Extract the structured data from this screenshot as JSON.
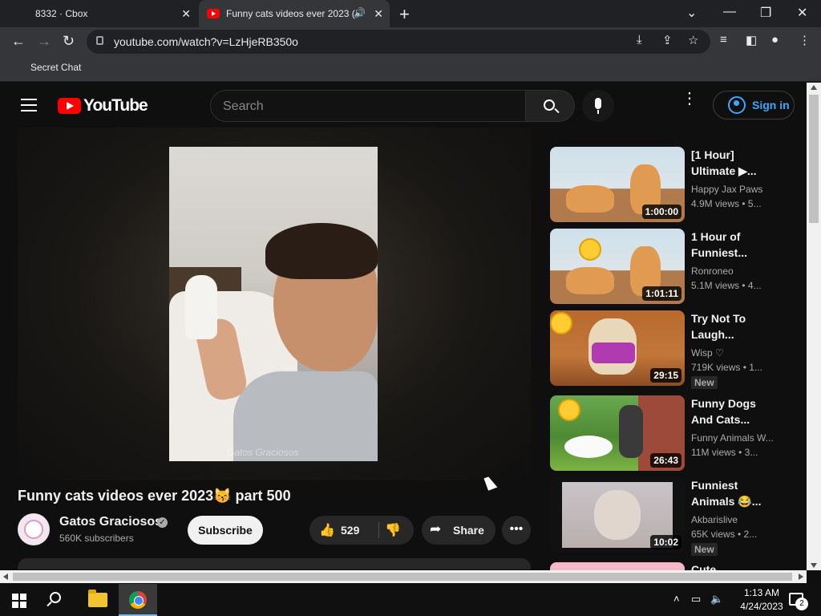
{
  "browser": {
    "tabs": [
      {
        "title": "8332 · Cbox"
      },
      {
        "title": "Funny cats videos ever 2023 (",
        "audio_icon": "speaker-icon"
      }
    ],
    "url": "youtube.com/watch?v=LzHjeRB350o",
    "bookmarks": [
      "Secret Chat"
    ]
  },
  "youtube": {
    "logo_text": "YouTube",
    "search_placeholder": "Search",
    "sign_in_label": "Sign in",
    "accent_color": "#3ea6ff"
  },
  "video": {
    "watermark": "Gatos Graciosos",
    "title": "Funny cats videos ever 2023😽 part 500",
    "channel": "Gatos Graciosos",
    "subscribers": "560K subscribers",
    "subscribe_label": "Subscribe",
    "likes": "529",
    "share_label": "Share"
  },
  "recommendations": [
    {
      "title": "[1 Hour] Ultimate ▶...",
      "channel": "Happy Jax Paws",
      "views": "4.9M views  •  5...",
      "duration": "1:00:00",
      "badge": ""
    },
    {
      "title": "1 Hour of Funniest...",
      "channel": "Ronroneo",
      "views": "5.1M views  •  4...",
      "duration": "1:01:11",
      "badge": ""
    },
    {
      "title": "Try Not To Laugh...",
      "channel": "Wisp ♡",
      "views": "719K views  •  1...",
      "duration": "29:15",
      "badge": "New"
    },
    {
      "title": "Funny Dogs And Cats...",
      "channel": "Funny Animals W...",
      "views": "11M views  •  3...",
      "duration": "26:43",
      "badge": ""
    },
    {
      "title": "Funniest Animals 😂...",
      "channel": "Akbarislive",
      "views": "65K views  •  2...",
      "duration": "10:02",
      "badge": "New"
    },
    {
      "title": "Cute",
      "channel": "",
      "views": "",
      "duration": "",
      "badge": ""
    }
  ],
  "taskbar": {
    "time": "1:13 AM",
    "date": "4/24/2023",
    "notification_count": "2"
  }
}
